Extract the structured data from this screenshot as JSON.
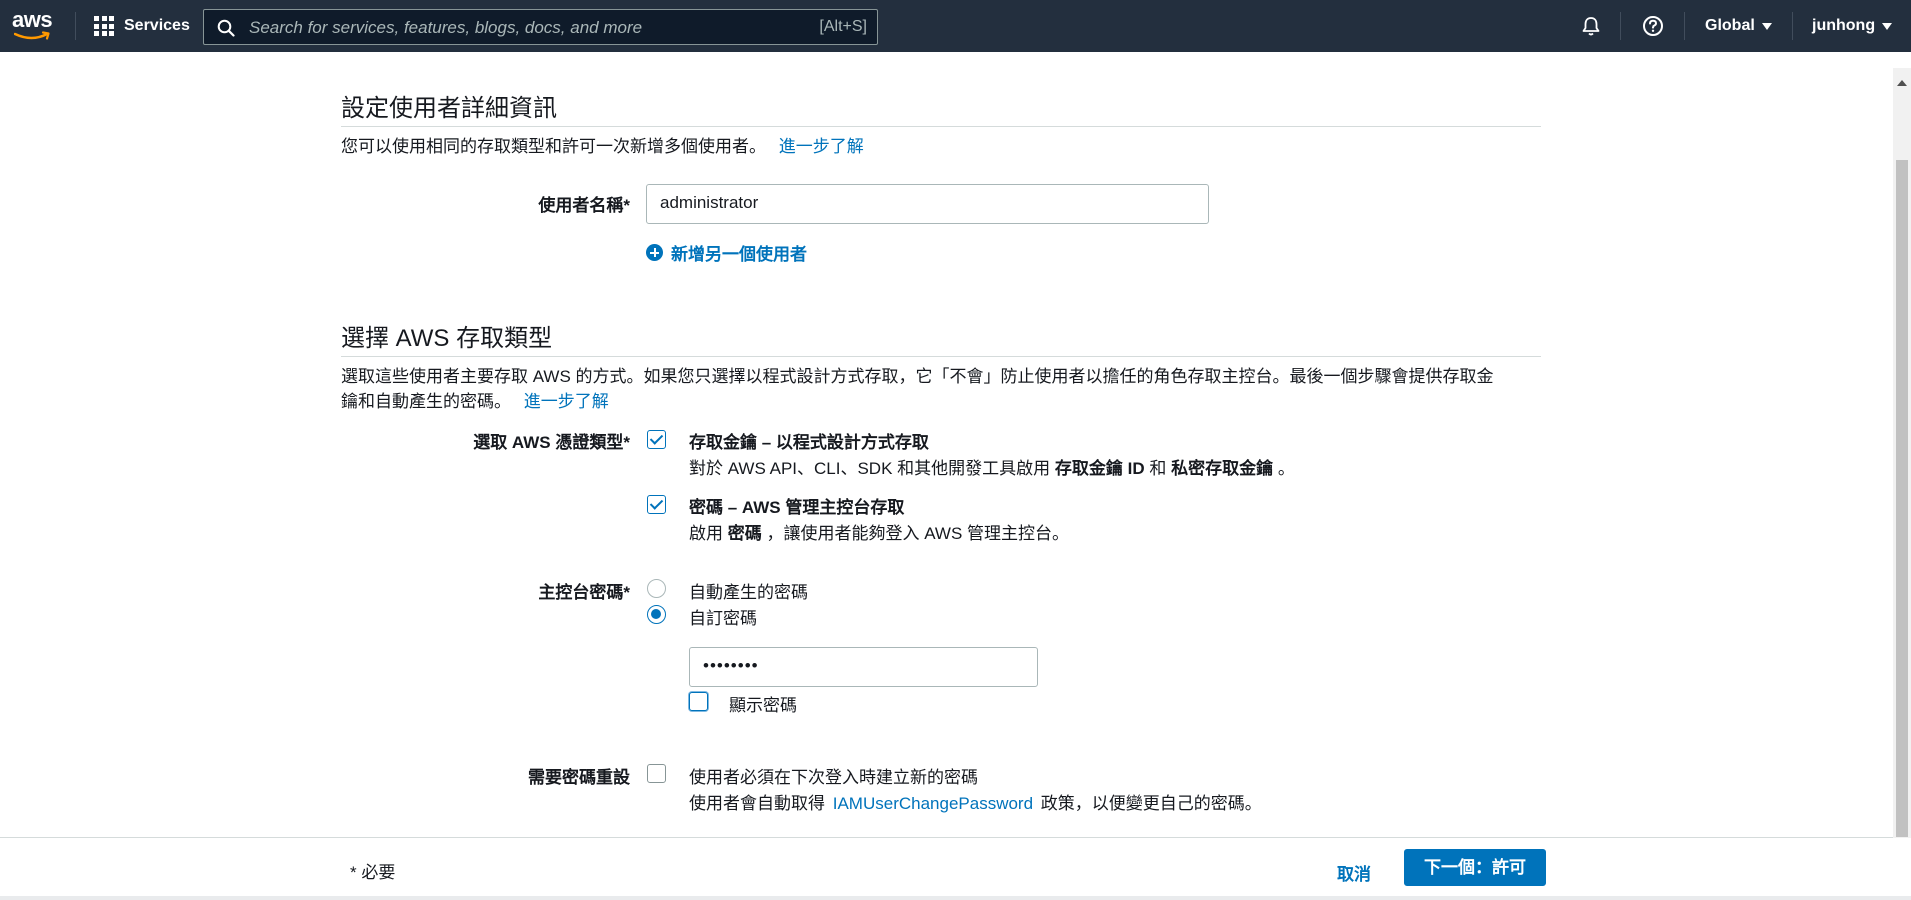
{
  "nav": {
    "logo_text": "aws",
    "services_label": "Services",
    "search_placeholder": "Search for services, features, blogs, docs, and more",
    "search_shortcut": "[Alt+S]",
    "region_label": "Global",
    "user_label": "junhong"
  },
  "user_details": {
    "title": "設定使用者詳細資訊",
    "description": "您可以使用相同的存取類型和許可一次新增多個使用者。",
    "learn_more": "進一步了解",
    "username_label": "使用者名稱*",
    "username_value": "administrator",
    "add_user_label": "新增另一個使用者"
  },
  "access_type": {
    "title": "選擇 AWS 存取類型",
    "description_line1": "選取這些使用者主要存取 AWS 的方式。如果您只選擇以程式設計方式存取，它「不會」防止使用者以擔任的角色存取主控台。最後一個步驟會提供存取金",
    "description_line2": "鑰和自動產生的密碼。",
    "learn_more": "進一步了解",
    "credential_label": "選取 AWS 憑證類型*",
    "programmatic": {
      "checked": true,
      "title": "存取金鑰 – 以程式設計方式存取",
      "desc_prefix": "對於 AWS API、CLI、SDK 和其他開發工具啟用",
      "desc_bold1": "存取金鑰 ID",
      "desc_mid": "和",
      "desc_bold2": "私密存取金鑰",
      "desc_suffix": "。"
    },
    "console": {
      "checked": true,
      "title": "密碼 – AWS 管理主控台存取",
      "desc_prefix": "啟用",
      "desc_bold": "密碼",
      "desc_suffix": "，讓使用者能夠登入 AWS 管理主控台。"
    },
    "console_password_label": "主控台密碼*",
    "password_options": [
      "自動產生的密碼",
      "自訂密碼"
    ],
    "password_selected": "自訂密碼",
    "password_value": "••••••••",
    "show_password_label": "顯示密碼",
    "reset_label": "需要密碼重設",
    "reset_checked": false,
    "reset_line1": "使用者必須在下次登入時建立新的密碼",
    "reset_line2_prefix": "使用者會自動取得",
    "reset_line2_link": "IAMUserChangePassword",
    "reset_line2_suffix": "政策，以便變更自己的密碼。"
  },
  "footer": {
    "required_note": "* 必要",
    "cancel_label": "取消",
    "next_label": "下一個：許可"
  },
  "colors": {
    "nav_bg": "#232f3e",
    "link": "#0073bb",
    "primary_button": "#0073bb"
  }
}
